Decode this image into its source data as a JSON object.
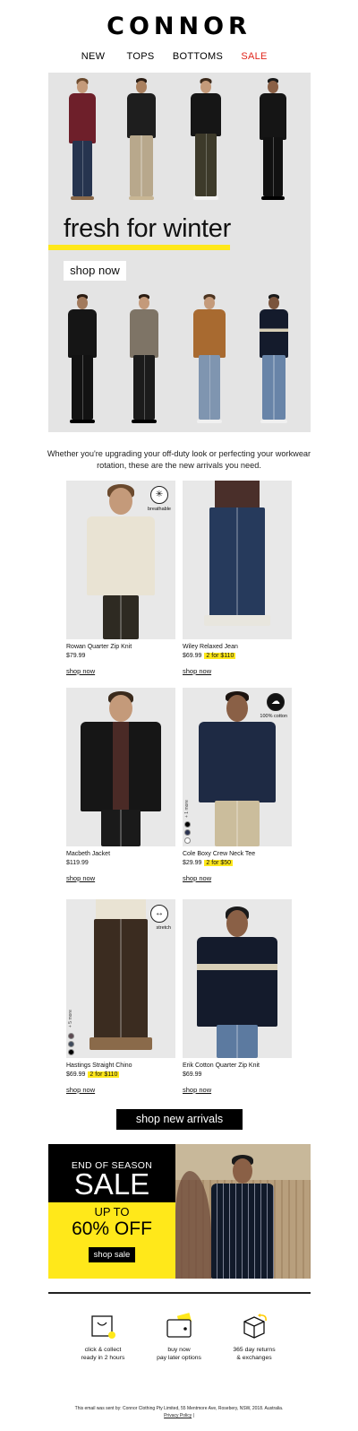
{
  "brand": {
    "logo": "CONNOR"
  },
  "nav": {
    "items": [
      {
        "label": "NEW"
      },
      {
        "label": "TOPS"
      },
      {
        "label": "BOTTOMS"
      },
      {
        "label": "SALE"
      }
    ],
    "sale_color": "#e1251b"
  },
  "hero": {
    "title": "fresh for winter",
    "button": "shop now",
    "accent": "#ffe81a",
    "background": "#e4e4e4"
  },
  "intro": {
    "text": "Whether you're upgrading your off-duty look or perfecting your workwear rotation, these are the new arrivals you need."
  },
  "products": [
    {
      "name": "Rowan Quarter Zip Knit",
      "price": "$79.99",
      "promo": "",
      "shop": "shop now",
      "badge": "breathable",
      "badge_icon": "breathable-icon"
    },
    {
      "name": "Wiley Relaxed Jean",
      "price": "$69.99",
      "promo": "2 for $110",
      "shop": "shop now",
      "badge": "",
      "badge_icon": ""
    },
    {
      "name": "Macbeth Jacket",
      "price": "$119.99",
      "promo": "",
      "shop": "shop now",
      "badge": "",
      "badge_icon": ""
    },
    {
      "name": "Cole Boxy Crew Neck Tee",
      "price": "$29.99",
      "promo": "2 for $50",
      "shop": "shop now",
      "badge": "100% cotton",
      "badge_icon": "cotton-icon",
      "more": "+ 1 more"
    },
    {
      "name": "Hastings Straight Chino",
      "price": "$69.99",
      "promo": "2 for $110",
      "shop": "shop now",
      "badge": "stretch",
      "badge_icon": "stretch-icon",
      "more": "+ 5 more"
    },
    {
      "name": "Erik Cotton Quarter Zip Knit",
      "price": "$69.99",
      "promo": "",
      "shop": "shop now",
      "badge": "",
      "badge_icon": ""
    }
  ],
  "cta": {
    "label": "shop new arrivals"
  },
  "sale": {
    "line1": "END OF SEASON",
    "line2": "SALE",
    "line3": "UP TO",
    "line4": "60% OFF",
    "button": "shop sale"
  },
  "features": [
    {
      "label1": "click & collect",
      "label2": "ready in 2 hours",
      "icon": "shopping-bag-icon"
    },
    {
      "label1": "buy now",
      "label2": "pay later options",
      "icon": "wallet-icon"
    },
    {
      "label1": "365 day returns",
      "label2": "& exchanges",
      "icon": "return-box-icon"
    }
  ],
  "footer": {
    "text": "This email was sent by: Connor Clothing Pty Limited, 55 Mentmore Ave, Rosebery, NSW, 2018. Australia.",
    "privacy": "Privacy Policy",
    "sep": "|"
  }
}
